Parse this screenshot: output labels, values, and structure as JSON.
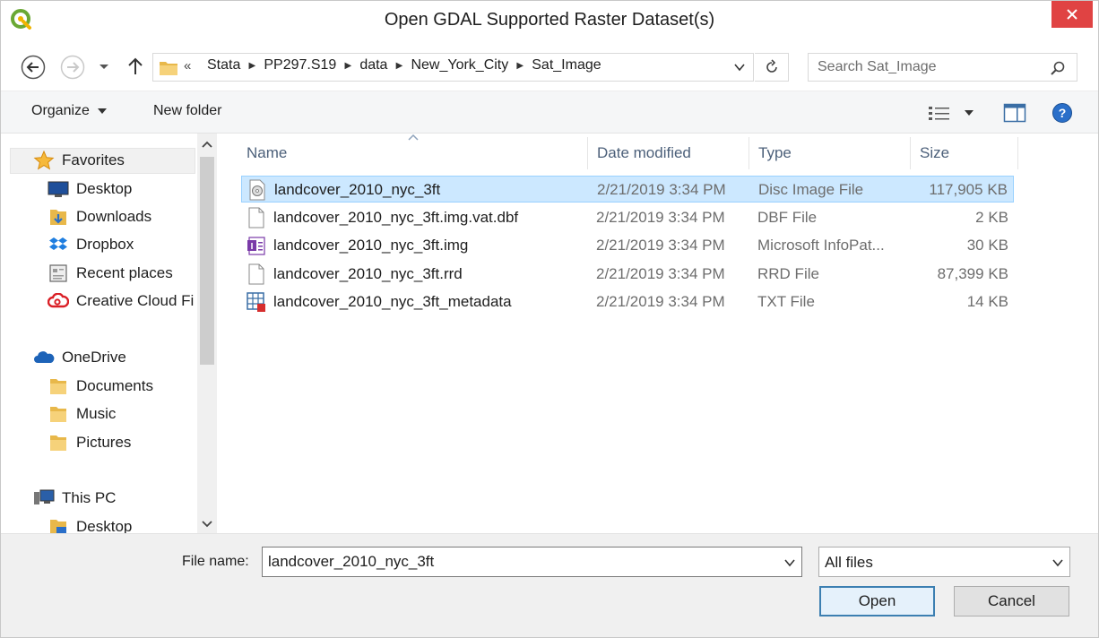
{
  "window": {
    "title": "Open GDAL Supported Raster Dataset(s)",
    "app_icon": "qgis-icon",
    "close_icon": "close-icon",
    "accent_color": "#e04343"
  },
  "navigation": {
    "overflow_label": "«",
    "breadcrumbs": [
      "Stata",
      "PP297.S19",
      "data",
      "New_York_City",
      "Sat_Image"
    ],
    "search_placeholder": "Search Sat_Image"
  },
  "toolbar": {
    "organize_label": "Organize",
    "new_folder_label": "New folder"
  },
  "sidebar": {
    "favorites": {
      "label": "Favorites",
      "items": [
        "Desktop",
        "Downloads",
        "Dropbox",
        "Recent places",
        "Creative Cloud Fi"
      ]
    },
    "onedrive": {
      "label": "OneDrive",
      "items": [
        "Documents",
        "Music",
        "Pictures"
      ]
    },
    "this_pc": {
      "label": "This PC",
      "items": [
        "Desktop"
      ]
    }
  },
  "file_list": {
    "columns": [
      "Name",
      "Date modified",
      "Type",
      "Size"
    ],
    "rows": [
      {
        "name": "landcover_2010_nyc_3ft",
        "date": "2/21/2019 3:34 PM",
        "type": "Disc Image File",
        "size": "117,905 KB",
        "icon": "disc-image-icon",
        "selected": true
      },
      {
        "name": "landcover_2010_nyc_3ft.img.vat.dbf",
        "date": "2/21/2019 3:34 PM",
        "type": "DBF File",
        "size": "2 KB",
        "icon": "blank-file-icon",
        "selected": false
      },
      {
        "name": "landcover_2010_nyc_3ft.img",
        "date": "2/21/2019 3:34 PM",
        "type": "Microsoft InfoPat...",
        "size": "30 KB",
        "icon": "infopath-icon",
        "selected": false
      },
      {
        "name": "landcover_2010_nyc_3ft.rrd",
        "date": "2/21/2019 3:34 PM",
        "type": "RRD File",
        "size": "87,399 KB",
        "icon": "blank-file-icon",
        "selected": false
      },
      {
        "name": "landcover_2010_nyc_3ft_metadata",
        "date": "2/21/2019 3:34 PM",
        "type": "TXT File",
        "size": "14 KB",
        "icon": "spreadsheet-file-icon",
        "selected": false
      }
    ]
  },
  "footer": {
    "file_name_label": "File name:",
    "file_name_value": "landcover_2010_nyc_3ft",
    "filter_value": "All files",
    "open_label": "Open",
    "cancel_label": "Cancel"
  }
}
